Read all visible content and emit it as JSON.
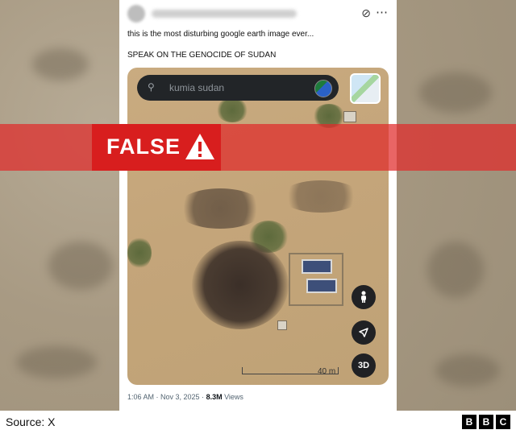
{
  "post": {
    "text_line1": "this is the most disturbing google earth image ever...",
    "text_line2": "SPEAK ON THE GENOCIDE OF SUDAN",
    "meta_time": "1:06 AM · Nov 3, 2025 · ",
    "meta_views_count": "8.3M",
    "meta_views_label": " Views"
  },
  "map": {
    "search_value": "kumia sudan",
    "btn_3d": "3D",
    "scale_label": "40 m"
  },
  "overlay": {
    "verdict": "FALSE",
    "verdict_color": "#d81e1e"
  },
  "footer": {
    "source": "Source: X",
    "logo_letters": [
      "B",
      "B",
      "C"
    ]
  },
  "icons": [
    "grok-icon",
    "more-icon",
    "search-icon",
    "layers-thumbnail",
    "street-view-icon",
    "navigate-icon",
    "warning-icon"
  ]
}
